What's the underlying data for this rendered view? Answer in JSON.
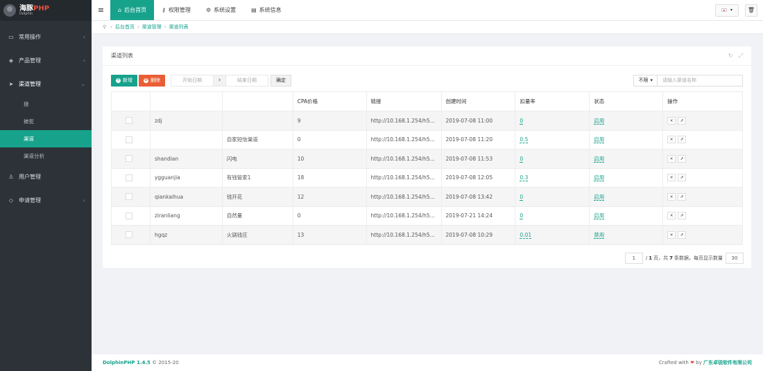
{
  "brand": {
    "name_cn": "海豚",
    "name_php": "PHP",
    "name_sub": "Dolphin"
  },
  "sidebar": {
    "items": [
      {
        "label": "常用操作",
        "icon": "folder-icon",
        "glyph": "▭",
        "chevron": "‹"
      },
      {
        "label": "产品管理",
        "icon": "cube-icon",
        "glyph": "◈",
        "chevron": "‹"
      },
      {
        "label": "渠道管理",
        "icon": "send-icon",
        "glyph": "➤",
        "chevron": "⌄"
      },
      {
        "label": "用户管理",
        "icon": "users-icon",
        "glyph": "♙",
        "chevron": ""
      },
      {
        "label": "申请管理",
        "icon": "tag-icon",
        "glyph": "◇",
        "chevron": "‹"
      }
    ],
    "subitems": [
      {
        "label": "接"
      },
      {
        "label": "被拒"
      },
      {
        "label": "渠道",
        "active": true
      },
      {
        "label": "渠道分析"
      }
    ]
  },
  "topbar": {
    "menu_icon": "≡",
    "tabs": [
      {
        "label": "后台首页",
        "icon": "home-icon",
        "glyph": "⌂",
        "active": true
      },
      {
        "label": "权限管理",
        "icon": "key-icon",
        "glyph": "⚷"
      },
      {
        "label": "系统设置",
        "icon": "gear-icon",
        "glyph": "⚙"
      },
      {
        "label": "系统信息",
        "icon": "doc-icon",
        "glyph": "▤"
      }
    ],
    "lang_caret": "▾",
    "trash_glyph": "🗑"
  },
  "breadcrumb": {
    "items": [
      "后台首页",
      "渠道管理",
      "渠道列表"
    ],
    "pin_glyph": "⚲",
    "sep": "›"
  },
  "panel": {
    "title": "渠道列表",
    "tool_refresh": "↻",
    "tool_expand": "⤢",
    "toolbar": {
      "add_label": "新增",
      "add_glyph": "+",
      "delete_label": "删除",
      "delete_glyph": "⊗",
      "start_date_placeholder": "开始日期",
      "date_sep": "›",
      "end_date_placeholder": "结束日期",
      "confirm_label": "确定",
      "search_filter": "不限",
      "search_caret": "▾",
      "search_placeholder": "请输入渠道名称"
    },
    "table": {
      "headers": [
        "",
        "",
        "",
        "CPA价格",
        "链接",
        "创建时间",
        "扣量率",
        "状态",
        "操作"
      ],
      "rows": [
        {
          "code": "zdj",
          "name": "",
          "cpa": "9",
          "link": "http://10.168.1.254/h5...",
          "created": "2019-07-08 11:00",
          "rate": "0",
          "status": "启用"
        },
        {
          "code": "",
          "name": "自家短信渠道",
          "cpa": "0",
          "link": "http://10.168.1.254/h5...",
          "created": "2019-07-08 11:20",
          "rate": "0.5",
          "status": "启用"
        },
        {
          "code": "shandian",
          "name": "闪电",
          "cpa": "10",
          "link": "http://10.168.1.254/h5...",
          "created": "2019-07-08 11:53",
          "rate": "0",
          "status": "启用"
        },
        {
          "code": "ygguanjia",
          "name": "有钱管家1",
          "cpa": "18",
          "link": "http://10.168.1.254/h5...",
          "created": "2019-07-08 12:05",
          "rate": "0.3",
          "status": "启用"
        },
        {
          "code": "qiankaihua",
          "name": "钱开花",
          "cpa": "12",
          "link": "http://10.168.1.254/h5...",
          "created": "2019-07-08 13:42",
          "rate": "0",
          "status": "启用"
        },
        {
          "code": "ziranliang",
          "name": "自然量",
          "cpa": "0",
          "link": "http://10.168.1.254/h5...",
          "created": "2019-07-21 14:24",
          "rate": "0",
          "status": "启用"
        },
        {
          "code": "hgqz",
          "name": "火锅钱庄",
          "cpa": "13",
          "link": "http://10.168.1.254/h5...",
          "created": "2019-07-08 10:29",
          "rate": "0.01",
          "status": "禁用"
        }
      ],
      "op_delete": "×",
      "op_edit": "⇗"
    },
    "pager": {
      "page": "1",
      "text_a": "/",
      "total_pages": "1",
      "text_b": "页，共",
      "total_count": "7",
      "text_c": "条数据，每页显示数量",
      "page_size": "30"
    }
  },
  "footer": {
    "product": "DolphinPHP 1.4.5",
    "copyright": "© 2015-20",
    "crafted_with": "Crafted with",
    "heart": "❤",
    "by": "by",
    "company": "广东卓锐软件有限公司"
  }
}
